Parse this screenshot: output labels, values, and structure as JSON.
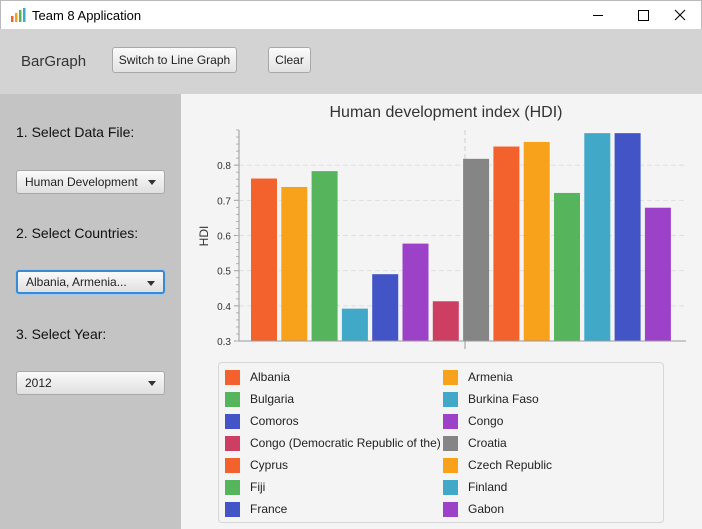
{
  "window": {
    "title": "Team 8 Application"
  },
  "toolbar": {
    "mode_label": "BarGraph",
    "switch_label": "Switch to Line Graph",
    "clear_label": "Clear"
  },
  "sidebar": {
    "step1": "1. Select Data File:",
    "file_value": "Human Development",
    "step2": "2. Select Countries:",
    "countries_value": "Albania,  Armenia...",
    "step3": "3. Select Year:",
    "year_value": "2012"
  },
  "colors": {
    "red": "#f3622d",
    "orange": "#f8a21c",
    "green": "#56b45c",
    "teal": "#41a8c8",
    "blue": "#4254c6",
    "purple": "#9c42c8",
    "crimson": "#cc3f62",
    "gray": "#858585"
  },
  "chart_data": {
    "type": "bar",
    "title": "Human development index (HDI)",
    "ylabel": "HDI",
    "ylim": [
      0.3,
      0.9
    ],
    "yticks": [
      "0.3",
      "0.4",
      "0.5",
      "0.6",
      "0.7",
      "0.8"
    ],
    "grid": true,
    "legend_position": "bottom",
    "series": [
      {
        "name": "Albania",
        "value": 0.762,
        "color": "#f3622d"
      },
      {
        "name": "Armenia",
        "value": 0.738,
        "color": "#f8a21c"
      },
      {
        "name": "Bulgaria",
        "value": 0.783,
        "color": "#56b45c"
      },
      {
        "name": "Burkina Faso",
        "value": 0.392,
        "color": "#41a8c8"
      },
      {
        "name": "Comoros",
        "value": 0.49,
        "color": "#4254c6"
      },
      {
        "name": "Congo",
        "value": 0.577,
        "color": "#9c42c8"
      },
      {
        "name": "Congo (Democratic Republic of the)",
        "value": 0.413,
        "color": "#cc3f62"
      },
      {
        "name": "Croatia",
        "value": 0.818,
        "color": "#858585"
      },
      {
        "name": "Cyprus",
        "value": 0.853,
        "color": "#f3622d"
      },
      {
        "name": "Czech Republic",
        "value": 0.866,
        "color": "#f8a21c"
      },
      {
        "name": "Fiji",
        "value": 0.721,
        "color": "#56b45c"
      },
      {
        "name": "Finland",
        "value": 0.891,
        "color": "#41a8c8"
      },
      {
        "name": "France",
        "value": 0.891,
        "color": "#4254c6"
      },
      {
        "name": "Gabon",
        "value": 0.679,
        "color": "#9c42c8"
      }
    ]
  }
}
